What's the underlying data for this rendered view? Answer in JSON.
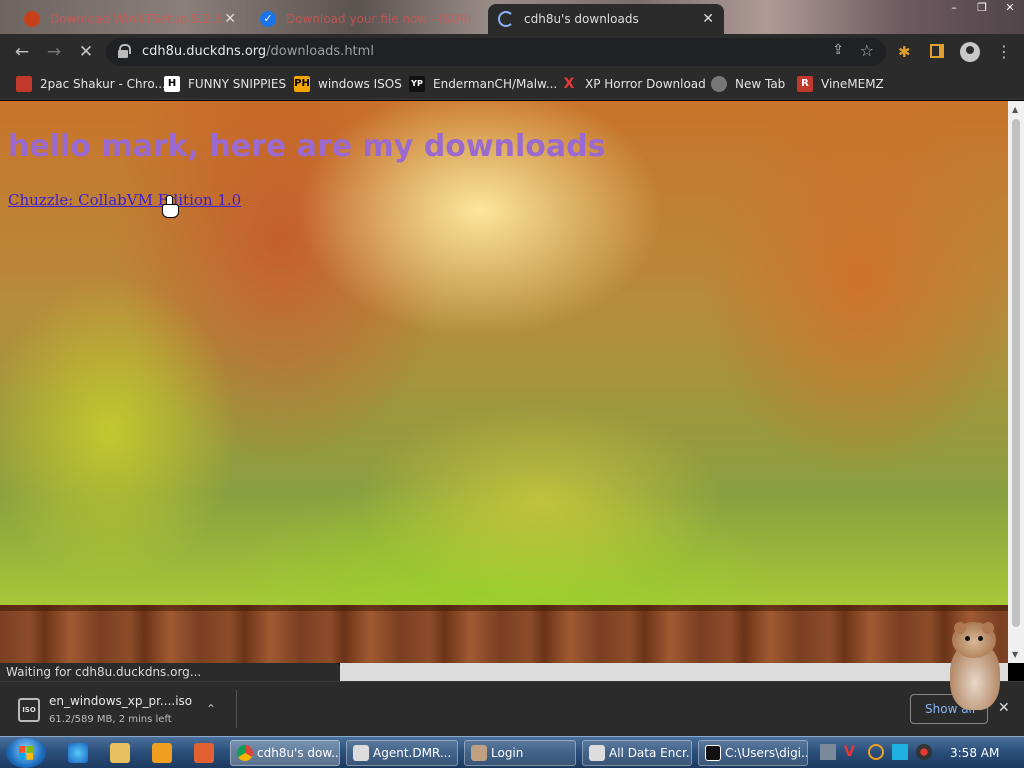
{
  "browser": {
    "tabs": [
      {
        "label": "Download WinNTSetup 5.2.3"
      },
      {
        "label": "Download your file now - ISORi"
      },
      {
        "label": "cdh8u's downloads"
      }
    ],
    "address": {
      "host": "cdh8u.duckdns.org",
      "path": "/downloads.html"
    },
    "bookmarks": [
      {
        "label": "2pac Shakur - Chro...",
        "icon_text": ""
      },
      {
        "label": "FUNNY SNIPPIES",
        "icon_text": "H"
      },
      {
        "label": "windows ISOS",
        "icon_text": "PH"
      },
      {
        "label": "EndermanCH/Malw...",
        "icon_text": "YP"
      },
      {
        "label": "XP Horror Download",
        "icon_text": "X"
      },
      {
        "label": "New Tab",
        "icon_text": ""
      },
      {
        "label": "VineMEMZ",
        "icon_text": "R"
      }
    ],
    "status": "Waiting for cdh8u.duckdns.org..."
  },
  "page": {
    "heading": "hello mark, here are my downloads",
    "link": "Chuzzle: CollabVM Edition 1.0"
  },
  "download_shelf": {
    "filename": "en_windows_xp_pr....iso",
    "progress": "61.2/589 MB, 2 mins left",
    "icon_text": "ISO",
    "show_all": "Show all"
  },
  "taskbar": {
    "windows": [
      {
        "label": "cdh8u's dow..."
      },
      {
        "label": "Agent.DMR..."
      },
      {
        "label": "Login"
      },
      {
        "label": "All Data Encr..."
      },
      {
        "label": "C:\\Users\\digi..."
      }
    ],
    "clock": "3:58 AM"
  },
  "colors": {
    "heading": "#9a6ad0",
    "link": "#3b1fd6",
    "chrome_dark": "#2b2b2b"
  }
}
